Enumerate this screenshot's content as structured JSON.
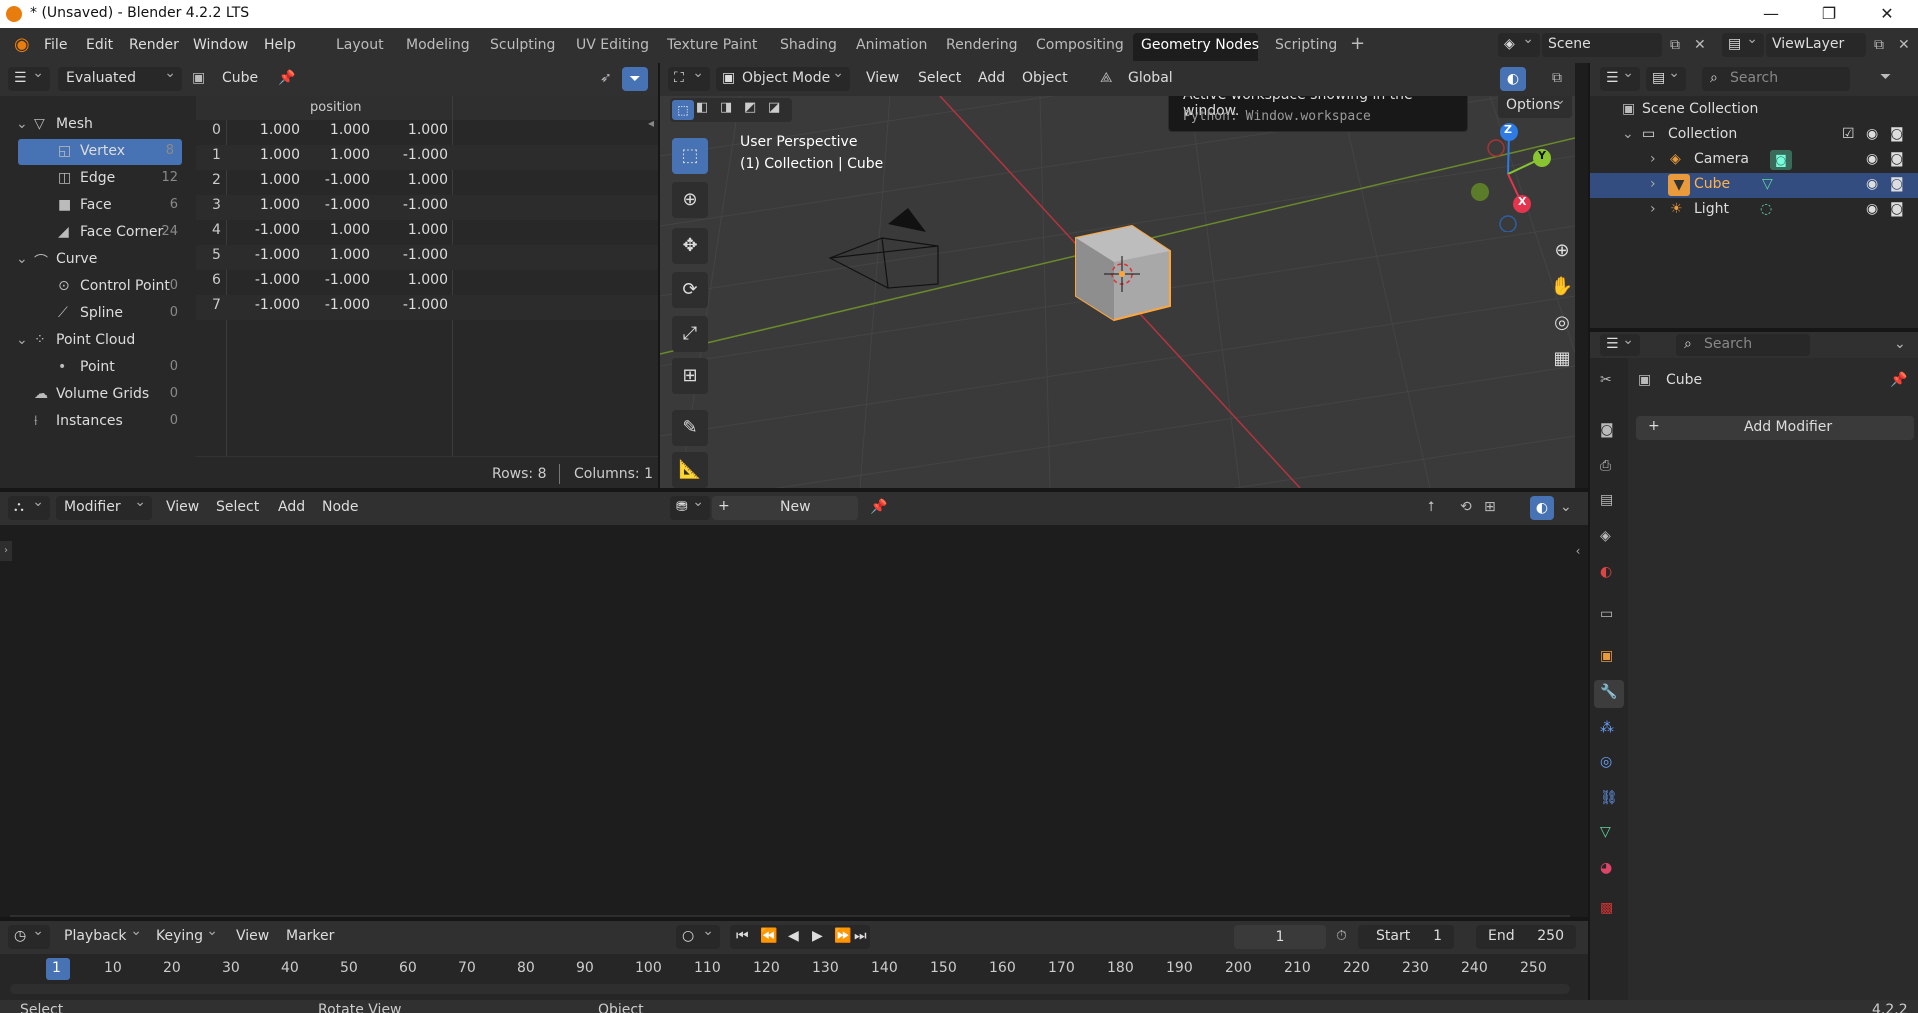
{
  "window": {
    "title": "* (Unsaved) - Blender 4.2.2 LTS",
    "controls": [
      "—",
      "❐",
      "✕"
    ]
  },
  "menu": [
    "File",
    "Edit",
    "Render",
    "Window",
    "Help"
  ],
  "workspaces": [
    "Layout",
    "Modeling",
    "Sculpting",
    "UV Editing",
    "Texture Paint",
    "Shading",
    "Animation",
    "Rendering",
    "Compositing",
    "Geometry Nodes",
    "Scripting"
  ],
  "active_workspace": "Geometry Nodes",
  "scene": {
    "name": "Scene",
    "view_layer": "ViewLayer"
  },
  "spreadsheet": {
    "mode": "Evaluated",
    "object": "Cube",
    "column_header": "position",
    "tree": [
      {
        "label": "Mesh",
        "count": "",
        "level": 0
      },
      {
        "label": "Vertex",
        "count": "8",
        "level": 1,
        "selected": true
      },
      {
        "label": "Edge",
        "count": "12",
        "level": 1
      },
      {
        "label": "Face",
        "count": "6",
        "level": 1
      },
      {
        "label": "Face Corner",
        "count": "24",
        "level": 1
      },
      {
        "label": "Curve",
        "count": "",
        "level": 0
      },
      {
        "label": "Control Point",
        "count": "0",
        "level": 1
      },
      {
        "label": "Spline",
        "count": "0",
        "level": 1
      },
      {
        "label": "Point Cloud",
        "count": "",
        "level": 0
      },
      {
        "label": "Point",
        "count": "0",
        "level": 1
      },
      {
        "label": "Volume Grids",
        "count": "0",
        "level": 0
      },
      {
        "label": "Instances",
        "count": "0",
        "level": 0
      }
    ],
    "rows": [
      {
        "i": "0",
        "v": [
          "1.000",
          "1.000",
          "1.000"
        ]
      },
      {
        "i": "1",
        "v": [
          "1.000",
          "1.000",
          "-1.000"
        ]
      },
      {
        "i": "2",
        "v": [
          "1.000",
          "-1.000",
          "1.000"
        ]
      },
      {
        "i": "3",
        "v": [
          "1.000",
          "-1.000",
          "-1.000"
        ]
      },
      {
        "i": "4",
        "v": [
          "-1.000",
          "1.000",
          "1.000"
        ]
      },
      {
        "i": "5",
        "v": [
          "-1.000",
          "1.000",
          "-1.000"
        ]
      },
      {
        "i": "6",
        "v": [
          "-1.000",
          "-1.000",
          "1.000"
        ]
      },
      {
        "i": "7",
        "v": [
          "-1.000",
          "-1.000",
          "-1.000"
        ]
      }
    ],
    "footer_rows": "Rows: 8",
    "footer_cols": "Columns: 1"
  },
  "viewport": {
    "mode": "Object Mode",
    "menu": [
      "View",
      "Select",
      "Add",
      "Object"
    ],
    "orientation": "Global",
    "options": "Options",
    "perspective": "User Perspective",
    "collection_info": "(1) Collection | Cube",
    "tooltip_title": "Active workspace showing in the window.",
    "tooltip_python": "Python: Window.workspace",
    "gizmo": {
      "z": "Z",
      "y": "Y",
      "x": "X"
    }
  },
  "outliner": {
    "search_placeholder": "Search",
    "scene_collection": "Scene Collection",
    "collection": "Collection",
    "items": [
      "Camera",
      "Cube",
      "Light"
    ]
  },
  "properties": {
    "search_placeholder": "Search",
    "object": "Cube",
    "add_modifier": "Add Modifier"
  },
  "node_editor": {
    "type": "Modifier",
    "menu": [
      "View",
      "Select",
      "Add",
      "Node"
    ],
    "new_button": "New"
  },
  "timeline": {
    "menu": [
      "Playback",
      "Keying",
      "View",
      "Marker"
    ],
    "current_frame": "1",
    "start_label": "Start",
    "start": "1",
    "end_label": "End",
    "end": "250",
    "ruler": [
      "1",
      "10",
      "20",
      "30",
      "40",
      "50",
      "60",
      "70",
      "80",
      "90",
      "100",
      "110",
      "120",
      "130",
      "140",
      "150",
      "160",
      "170",
      "180",
      "190",
      "200",
      "210",
      "220",
      "230",
      "240",
      "250"
    ]
  },
  "statusbar": {
    "select": "Select",
    "rotate": "Rotate View",
    "object": "Object",
    "version": "4.2.2"
  },
  "colors": {
    "accent": "#4772b3",
    "selection_outline": "#ffa53a",
    "x_axis": "#e5344d",
    "y_axis": "#89c431",
    "z_axis": "#2d7be3"
  }
}
